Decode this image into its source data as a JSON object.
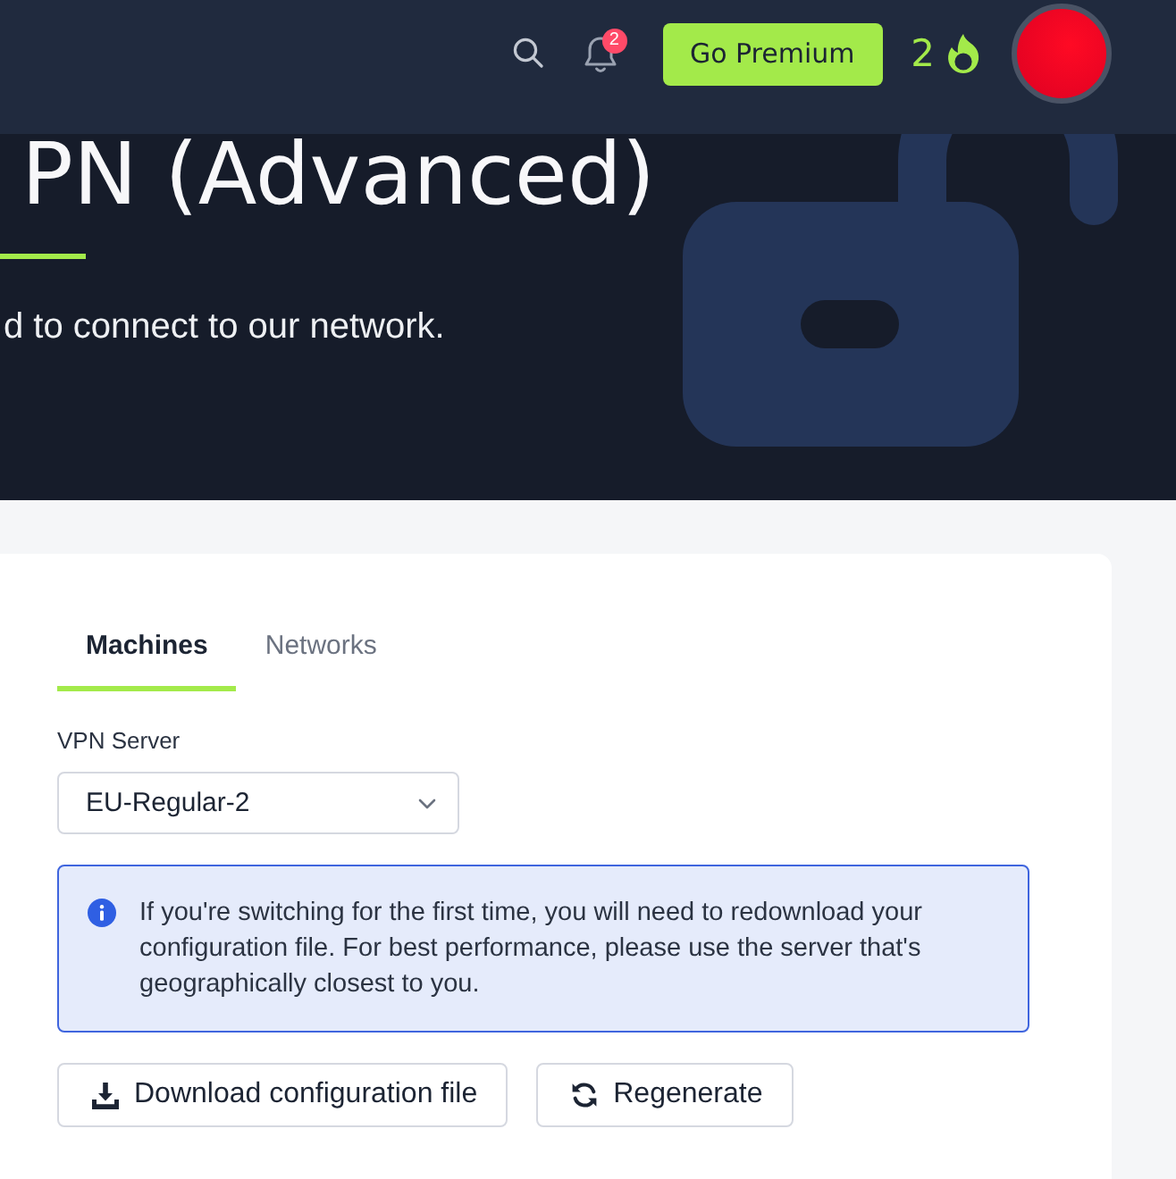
{
  "header": {
    "notification_badge": "2",
    "premium_button": "Go Premium",
    "streak_count": "2"
  },
  "hero": {
    "title": "PN (Advanced)",
    "subtitle": "d to connect to our network."
  },
  "tabs": [
    {
      "label": "Machines",
      "selected": true
    },
    {
      "label": "Networks",
      "selected": false
    }
  ],
  "vpn_server": {
    "label": "VPN Server",
    "value": "EU-Regular-2"
  },
  "info_alert": {
    "text": "If you're switching for the first time, you will need to redownload your configuration file. For best performance, please use the server that's geographically closest to you."
  },
  "buttons": [
    {
      "label": "Download configuration file",
      "kind": "download"
    },
    {
      "label": "Regenerate",
      "kind": "regenerate"
    }
  ]
}
